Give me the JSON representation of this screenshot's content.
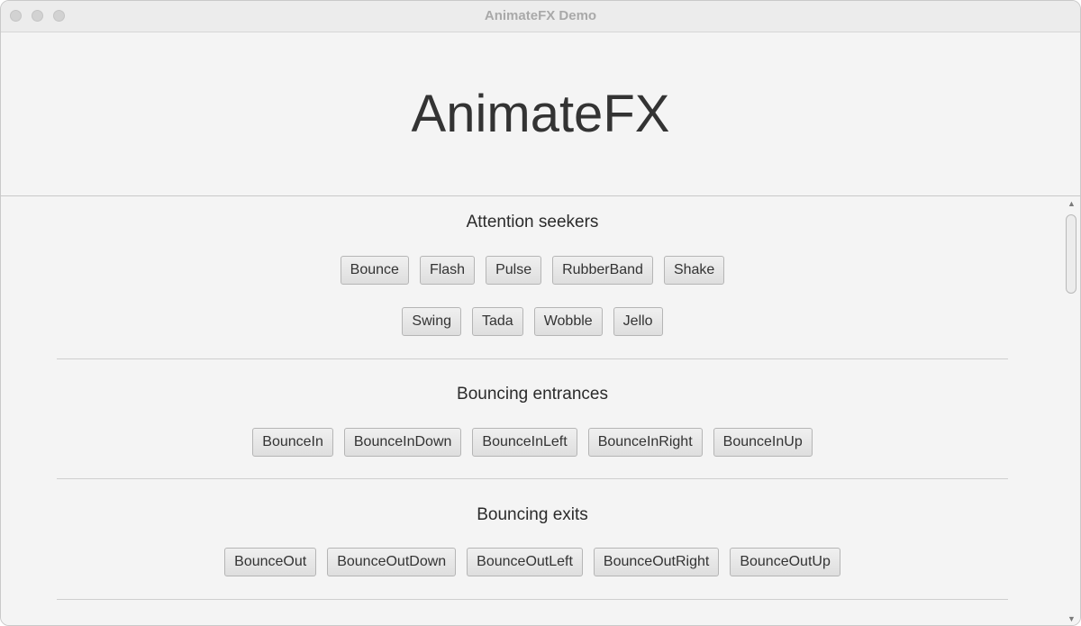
{
  "window": {
    "title": "AnimateFX Demo"
  },
  "header": {
    "title": "AnimateFX"
  },
  "sections": [
    {
      "title": "Attention seekers",
      "rows": [
        [
          "Bounce",
          "Flash",
          "Pulse",
          "RubberBand",
          "Shake"
        ],
        [
          "Swing",
          "Tada",
          "Wobble",
          "Jello"
        ]
      ]
    },
    {
      "title": "Bouncing entrances",
      "rows": [
        [
          "BounceIn",
          "BounceInDown",
          "BounceInLeft",
          "BounceInRight",
          "BounceInUp"
        ]
      ]
    },
    {
      "title": "Bouncing exits",
      "rows": [
        [
          "BounceOut",
          "BounceOutDown",
          "BounceOutLeft",
          "BounceOutRight",
          "BounceOutUp"
        ]
      ]
    }
  ],
  "scrollbar": {
    "up_icon": "triangle-up-icon",
    "down_icon": "triangle-down-icon"
  }
}
